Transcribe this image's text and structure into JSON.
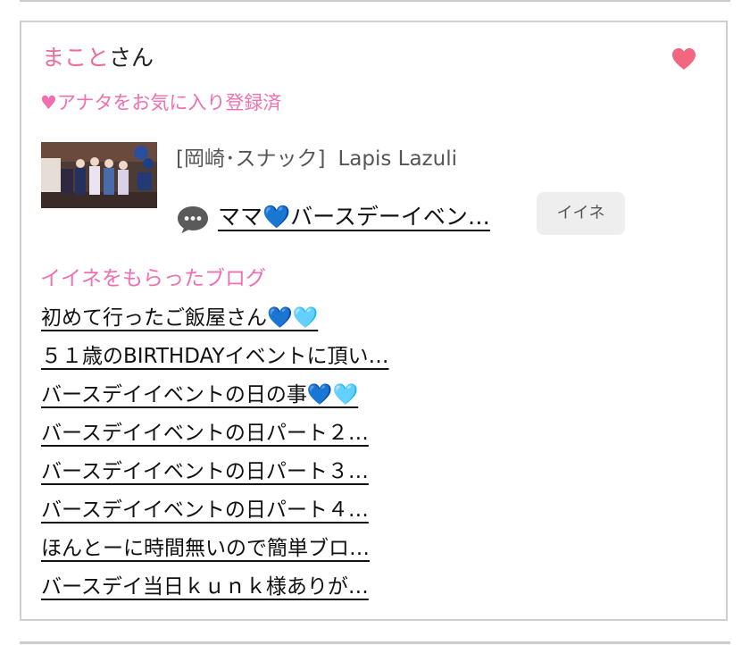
{
  "card": {
    "user_name": "まこと",
    "user_suffix": "さん",
    "favorite_icon": "heart-icon",
    "favorite_status": "♥アナタをお気に入り登録済",
    "shop": {
      "location_category": "[岡崎･スナック]",
      "name": "Lapis Lazuli",
      "thumbnail_icon": "photo-thumbnail"
    },
    "latest_post": {
      "icon": "speech-bubble-icon",
      "title": "ママ💙バースデーイベン…",
      "like_button_label": "イイネ"
    },
    "liked_blogs": {
      "title": "イイネをもらったブログ",
      "items": [
        "初めて行ったご飯屋さん💙🩵",
        "５１歳のBIRTHDAYイベントに頂い…",
        "バースデイイベントの日の事💙🩵",
        "バースデイイベントの日パート２…",
        "バースデイイベントの日パート３…",
        "バースデイイベントの日パート４…",
        "ほんとーに時間無いので簡単ブロ…",
        "バースデイ当日ｋｕｎｋ様ありが…"
      ]
    }
  },
  "colors": {
    "accent_pink": "#f06fb0",
    "heart": "#f2667f",
    "border": "#cfcfcf",
    "button_bg": "#eeeeee"
  }
}
